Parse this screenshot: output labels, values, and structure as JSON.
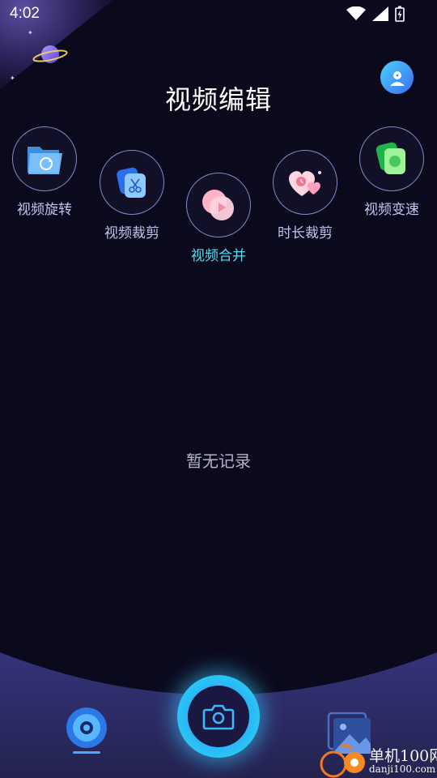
{
  "status_bar": {
    "time": "4:02"
  },
  "header": {
    "title": "视频编辑"
  },
  "tools": [
    {
      "label": "视频旋转",
      "icon": "folder-rotate-icon"
    },
    {
      "label": "视频裁剪",
      "icon": "scissors-card-icon"
    },
    {
      "label": "视频合并",
      "icon": "merge-play-icon",
      "active": true
    },
    {
      "label": "时长裁剪",
      "icon": "heart-clock-icon"
    },
    {
      "label": "视频变速",
      "icon": "speed-cards-icon"
    }
  ],
  "empty_state": {
    "text": "暂无记录"
  },
  "watermark": {
    "title": "单机100网",
    "url": "danji100.com"
  },
  "colors": {
    "background": "#0b0a1d",
    "accent": "#4fe0f2",
    "bottom_panel": "#2b2a66"
  }
}
